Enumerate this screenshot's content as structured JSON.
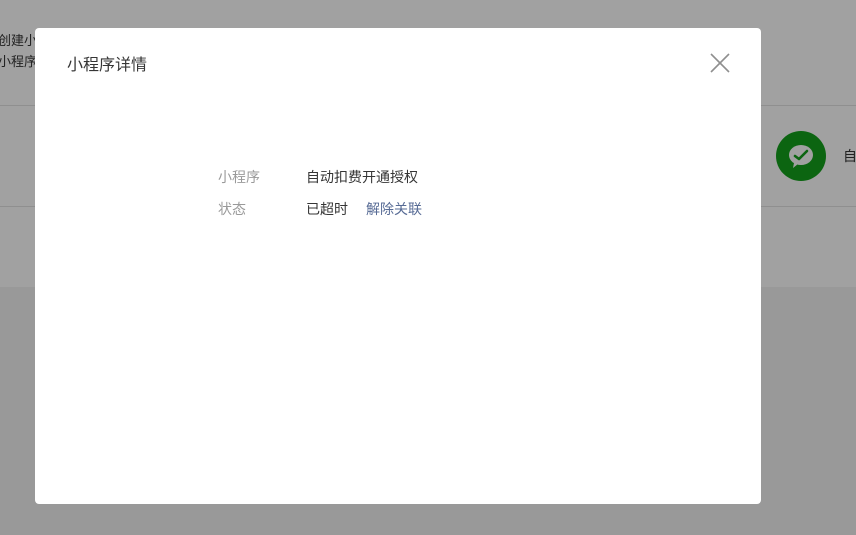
{
  "background": {
    "top_texts": [
      "创建小",
      "小程序"
    ],
    "side_label": "自",
    "wechat_icon": "wechat-icon",
    "wechat_color": "#13a01b"
  },
  "dialog": {
    "title": "小程序详情",
    "close_icon": "close-icon",
    "rows": [
      {
        "label": "小程序",
        "value": "自动扣费开通授权"
      },
      {
        "label": "状态",
        "value": "已超时",
        "link": "解除关联"
      }
    ],
    "link_color": "#576b95"
  }
}
